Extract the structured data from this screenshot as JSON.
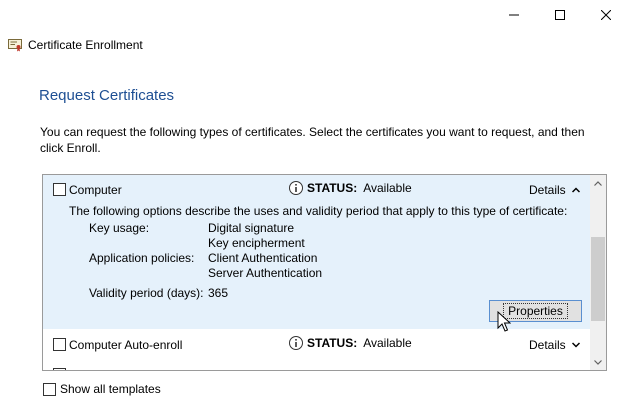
{
  "window": {
    "title": "Certificate Enrollment",
    "controls": [
      "minimize-icon",
      "maximize-icon",
      "close-icon"
    ]
  },
  "page": {
    "title": "Request Certificates",
    "intro": "You can request the following types of certificates. Select the certificates you want to request, and then click Enroll."
  },
  "items": [
    {
      "name": "Computer",
      "checked": false,
      "status_label": "STATUS:",
      "status_value": "Available",
      "details_label": "Details",
      "expanded": true,
      "description": "The following options describe the uses and validity period that apply to this type of certificate:",
      "key_usage_label": "Key usage:",
      "key_usage_values": [
        "Digital signature",
        "Key encipherment"
      ],
      "app_policies_label": "Application policies:",
      "app_policies_values": [
        "Client Authentication",
        "Server Authentication"
      ],
      "validity_label": "Validity period (days):",
      "validity_value": "365",
      "properties_button": "Properties"
    },
    {
      "name": "Computer Auto-enroll",
      "checked": false,
      "status_label": "STATUS:",
      "status_value": "Available",
      "details_label": "Details",
      "expanded": false
    }
  ],
  "footer": {
    "show_all_label": "Show all templates"
  },
  "colors": {
    "title_blue": "#1e4f93",
    "selected_row": "#e5f1fb",
    "button_border": "#5a8fd0"
  }
}
